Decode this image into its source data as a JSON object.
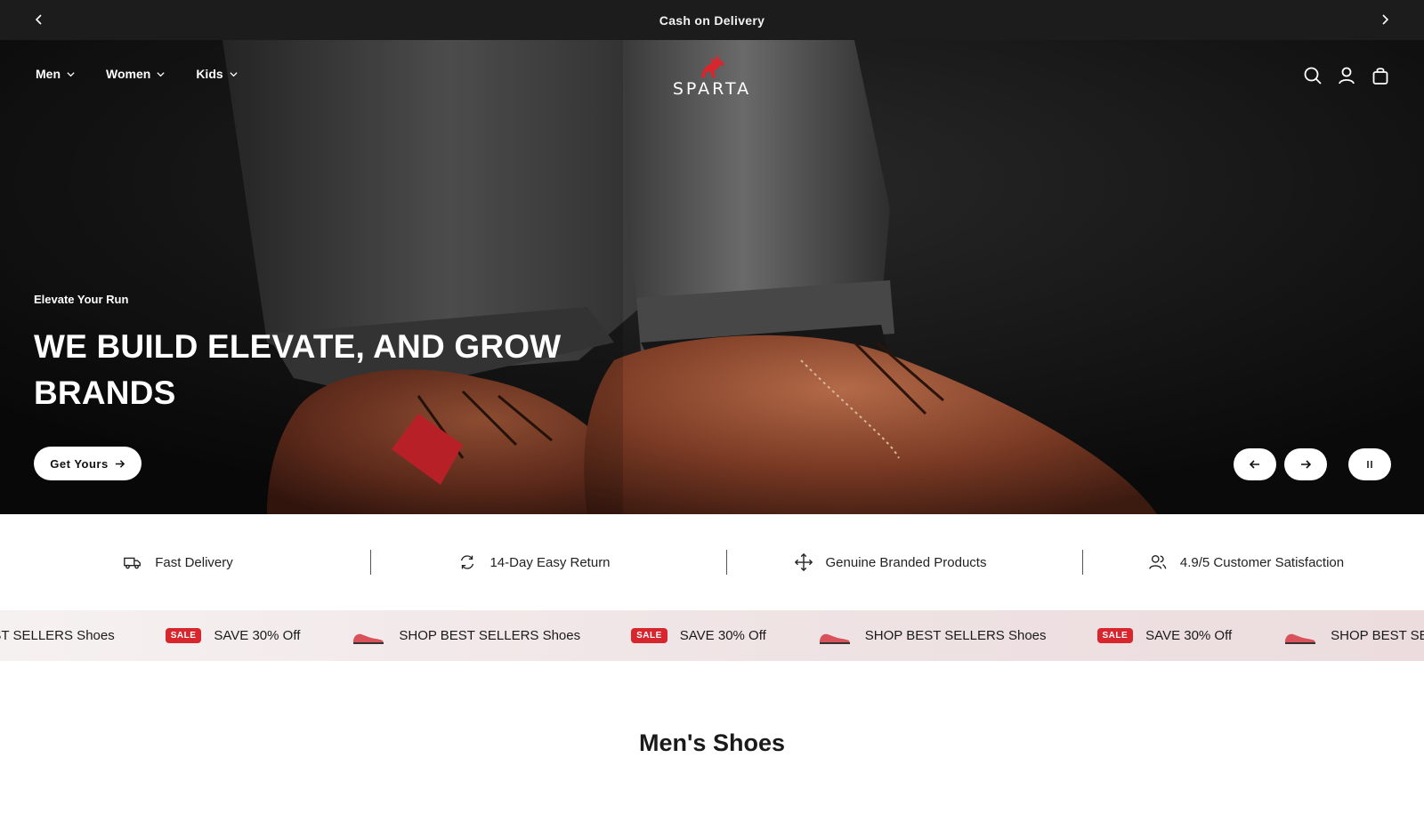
{
  "announcement": {
    "text": "Cash on Delivery"
  },
  "nav": {
    "items": [
      {
        "label": "Men"
      },
      {
        "label": "Women"
      },
      {
        "label": "Kids"
      }
    ]
  },
  "brand": {
    "name": "SPARTA",
    "accent": "#d7262e"
  },
  "icons": {
    "search": "search-icon",
    "account": "user-icon",
    "cart": "bag-icon"
  },
  "hero": {
    "subtitle": "Elevate Your Run",
    "title": "WE BUILD ELEVATE, AND GROW BRANDS",
    "cta_label": "Get Yours"
  },
  "features": [
    {
      "label": "Fast Delivery",
      "icon": "truck-icon"
    },
    {
      "label": "14-Day Easy Return",
      "icon": "return-icon"
    },
    {
      "label": "Genuine Branded Products",
      "icon": "move-icon"
    },
    {
      "label": "4.9/5 Customer Satisfaction",
      "icon": "users-icon"
    }
  ],
  "marquee": {
    "sale_badge": "SALE",
    "sale_text": "SAVE 30% Off",
    "best_text": "SHOP BEST SELLERS Shoes"
  },
  "section": {
    "title": "Men's Shoes"
  },
  "colors": {
    "topbar": "#1c1c1c",
    "sale": "#d7262e",
    "marquee_bg": "#efe3e4"
  }
}
